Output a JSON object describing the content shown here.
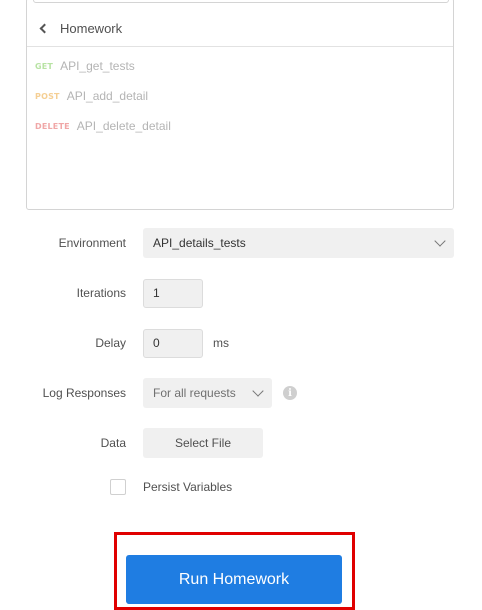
{
  "collection": {
    "title": "Homework",
    "requests": [
      {
        "method": "GET",
        "name": "API_get_tests"
      },
      {
        "method": "POST",
        "name": "API_add_detail"
      },
      {
        "method": "DELETE",
        "name": "API_delete_detail"
      }
    ]
  },
  "form": {
    "environment": {
      "label": "Environment",
      "value": "API_details_tests"
    },
    "iterations": {
      "label": "Iterations",
      "value": "1"
    },
    "delay": {
      "label": "Delay",
      "value": "0",
      "unit": "ms"
    },
    "log_responses": {
      "label": "Log Responses",
      "value": "For all requests",
      "info_glyph": "i"
    },
    "data": {
      "label": "Data",
      "button_label": "Select File"
    },
    "persist_variables": {
      "label": "Persist Variables",
      "checked": false
    }
  },
  "run_button": {
    "label": "Run Homework"
  },
  "colors": {
    "accent": "#1f7de2",
    "highlight": "#e00000",
    "method_get": "#b8e3a4",
    "method_post": "#f5cf94",
    "method_delete": "#f0a7a7"
  }
}
